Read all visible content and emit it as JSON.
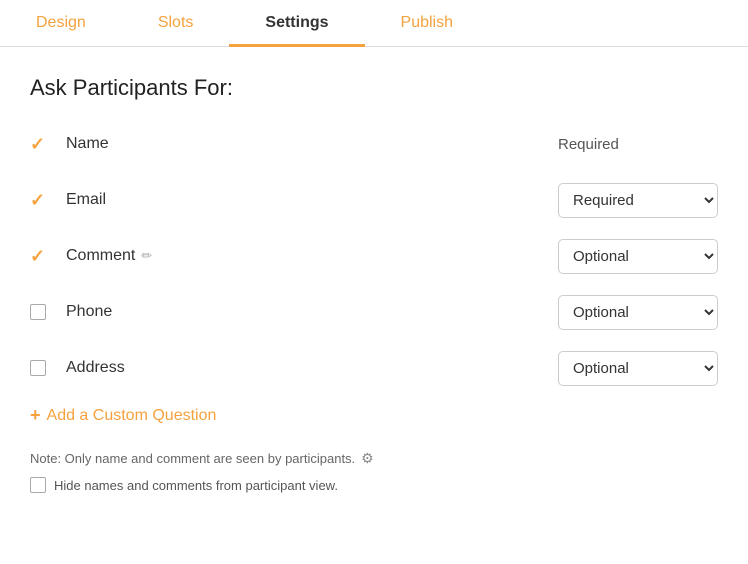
{
  "tabs": [
    {
      "id": "design",
      "label": "Design",
      "active": false
    },
    {
      "id": "slots",
      "label": "Slots",
      "active": false
    },
    {
      "id": "settings",
      "label": "Settings",
      "active": true
    },
    {
      "id": "publish",
      "label": "Publish",
      "active": false
    }
  ],
  "section": {
    "title": "Ask Participants For:"
  },
  "fields": [
    {
      "id": "name",
      "label": "Name",
      "checked": true,
      "editable": false,
      "control_type": "text",
      "control_value": "Required"
    },
    {
      "id": "email",
      "label": "Email",
      "checked": true,
      "editable": false,
      "control_type": "select",
      "control_value": "Required",
      "options": [
        "Required",
        "Optional"
      ]
    },
    {
      "id": "comment",
      "label": "Comment",
      "checked": true,
      "editable": true,
      "control_type": "select",
      "control_value": "Optional",
      "options": [
        "Required",
        "Optional"
      ]
    },
    {
      "id": "phone",
      "label": "Phone",
      "checked": false,
      "editable": false,
      "control_type": "select",
      "control_value": "Optional",
      "options": [
        "Required",
        "Optional"
      ]
    },
    {
      "id": "address",
      "label": "Address",
      "checked": false,
      "editable": false,
      "control_type": "select",
      "control_value": "Optional",
      "options": [
        "Required",
        "Optional"
      ]
    }
  ],
  "add_custom": {
    "label": "Add a Custom Question",
    "plus": "+"
  },
  "note": {
    "text": "Note: Only name and comment are seen by participants.",
    "hide_label": "Hide names and comments from participant view."
  },
  "icons": {
    "checkmark": "✓",
    "edit": "✏",
    "plus": "+",
    "gear": "⚙"
  }
}
